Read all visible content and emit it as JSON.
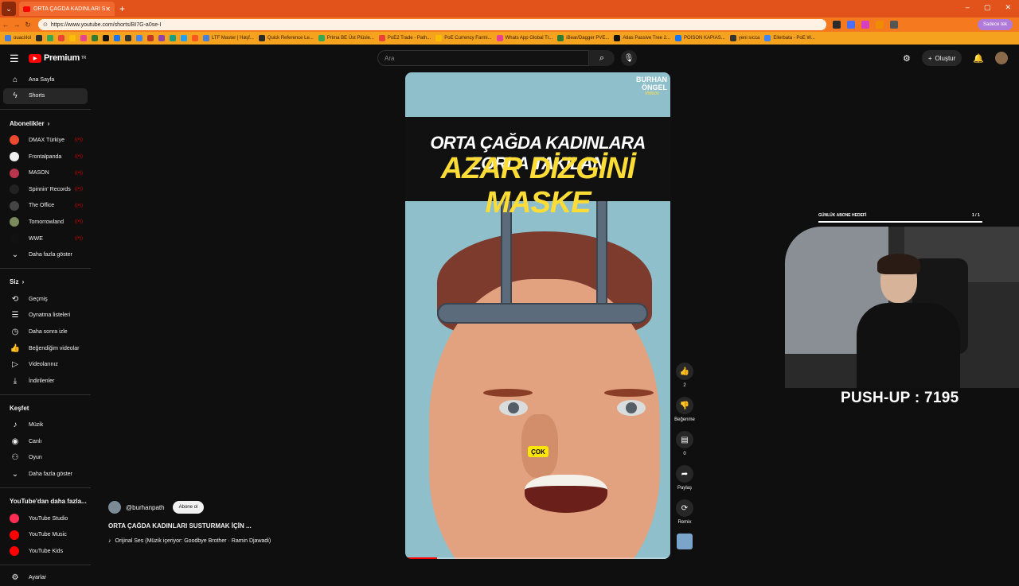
{
  "browser": {
    "tab_title": "ORTA ÇAĞDA KADINLARI SU",
    "url": "https://www.youtube.com/shorts/BI7G-a0se-I",
    "profile_label": "Sadece tek",
    "bookmarks": [
      "ouaclılol",
      "",
      "",
      "",
      "",
      "",
      "",
      "",
      "",
      "",
      "",
      "",
      "",
      "",
      "",
      "",
      "LTF Master | Høşf...",
      "Quick Reference Le...",
      "Prima BE Üst Plüsle...",
      "PoE2 Trade - Path...",
      "PoE Currency Farmi...",
      "Whats App Global Tr...",
      "iBear/Dagger PVE...",
      "Atlas Passive Tree 2...",
      "POISON KAPIAS...",
      "yeni sıcca",
      "Ellerbata - PoE W..."
    ]
  },
  "masthead": {
    "logo_text": "Premium",
    "logo_sup": "TR",
    "search_placeholder": "Ara",
    "create_label": "Oluştur"
  },
  "sidebar": {
    "main": [
      {
        "label": "Ana Sayfa",
        "icon": "home-icon"
      },
      {
        "label": "Shorts",
        "icon": "shorts-icon",
        "active": true
      }
    ],
    "subs_header": "Abonelikler",
    "subscriptions": [
      {
        "label": "DMAX Türkiye",
        "color": "#e8492f"
      },
      {
        "label": "Frontalpanda",
        "color": "#eeeeee"
      },
      {
        "label": "MASON",
        "color": "#b8354e"
      },
      {
        "label": "Spinnin' Records",
        "color": "#222222"
      },
      {
        "label": "The Office",
        "color": "#444444"
      },
      {
        "label": "Tomorrowland",
        "color": "#7a8a5c"
      },
      {
        "label": "WWE",
        "color": "#111111"
      }
    ],
    "subs_more": "Daha fazla göster",
    "you_header": "Siz",
    "you_items": [
      {
        "label": "Geçmiş",
        "icon": "history-icon"
      },
      {
        "label": "Oynatma listeleri",
        "icon": "playlist-icon"
      },
      {
        "label": "Daha sonra izle",
        "icon": "clock-icon"
      },
      {
        "label": "Beğendiğim videolar",
        "icon": "thumb-up-icon"
      },
      {
        "label": "Videolarınız",
        "icon": "video-icon"
      },
      {
        "label": "İndirilenler",
        "icon": "download-icon"
      }
    ],
    "explore_header": "Keşfet",
    "explore_items": [
      {
        "label": "Müzik",
        "icon": "music-icon"
      },
      {
        "label": "Canlı",
        "icon": "live-icon"
      },
      {
        "label": "Oyun",
        "icon": "gaming-icon"
      },
      {
        "label": "Daha fazla göster",
        "icon": "chevron-down-icon"
      }
    ],
    "more_header": "YouTube'dan daha fazla...",
    "more_items": [
      {
        "label": "YouTube Studio",
        "color": "#ff2d55"
      },
      {
        "label": "YouTube Music",
        "color": "#ff0000"
      },
      {
        "label": "YouTube Kids",
        "color": "#ff0000"
      }
    ],
    "settings_label": "Ayarlar"
  },
  "short": {
    "watermark_line1": "BURHAN",
    "watermark_line2": "ÖNGEL",
    "watermark_sub": "Videos",
    "overlay_line1": "ORTA ÇAĞDA KADINLARA ZORLA TAKILAN",
    "overlay_line2": "AZAR DİZGİNİ MASKE",
    "caption": "ÇOK",
    "progress": 0.12
  },
  "actions": {
    "like_count": "2",
    "dislike_label": "Beğenme",
    "comment_count": "0",
    "share_label": "Paylaş",
    "remix_label": "Remix"
  },
  "meta": {
    "channel": "@burhanpath",
    "subscribe_label": "Abone ol",
    "title": "ORTA ÇAĞDA KADINLARI SUSTURMAK İÇİN ...",
    "sound": "Orijinal Ses (Müzik içeriyor: Goodbye Brother · Ramin Djawadi)"
  },
  "overlay": {
    "goal_label": "GÜNLÜK ABONE HEDEFİ",
    "goal_count": "1 / 1",
    "goal_progress": 1.0,
    "pushup_text": "PUSH-UP : 7195"
  }
}
